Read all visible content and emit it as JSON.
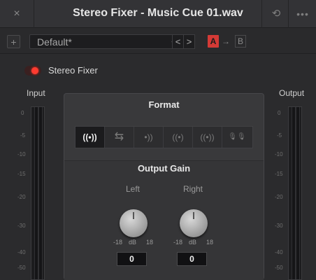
{
  "window": {
    "title": "Stereo Fixer - Music Cue 01.wav",
    "close_icon": "×",
    "history_icon": "⟲",
    "more_icon": "•••"
  },
  "toolbar": {
    "add_icon": "+",
    "preset_value": "Default*",
    "preset_chevron": "⌄",
    "prev_icon": "<",
    "next_icon": ">",
    "ab_a": "A",
    "ab_arrow": "→",
    "ab_b": "B",
    "accent_color": "#d43a36"
  },
  "plugin": {
    "enabled": true,
    "name": "Stereo Fixer",
    "toggle_color": "#ff3b30"
  },
  "meters": {
    "input_label": "Input",
    "output_label": "Output",
    "ticks": [
      "0",
      "-5",
      "-10",
      "-15",
      "-20",
      "-30",
      "-40",
      "-50"
    ]
  },
  "format": {
    "title": "Format",
    "buttons": [
      {
        "glyph": "((•))",
        "icon": "stereo-icon",
        "active": true
      },
      {
        "glyph": "⇆",
        "icon": "swap-channels-icon",
        "active": false
      },
      {
        "glyph": "•))",
        "icon": "right-only-icon",
        "active": false
      },
      {
        "glyph": "((•)",
        "icon": "left-only-icon",
        "active": false
      },
      {
        "glyph": "((•))",
        "icon": "mono-sum-icon",
        "active": false
      },
      {
        "glyph": "🎙🎙",
        "icon": "dual-mic-icon",
        "active": false
      }
    ]
  },
  "output_gain": {
    "title": "Output Gain",
    "left": {
      "label": "Left",
      "min": "-18",
      "unit": "dB",
      "max": "18",
      "value": "0"
    },
    "right": {
      "label": "Right",
      "min": "-18",
      "unit": "dB",
      "max": "18",
      "value": "0"
    }
  }
}
